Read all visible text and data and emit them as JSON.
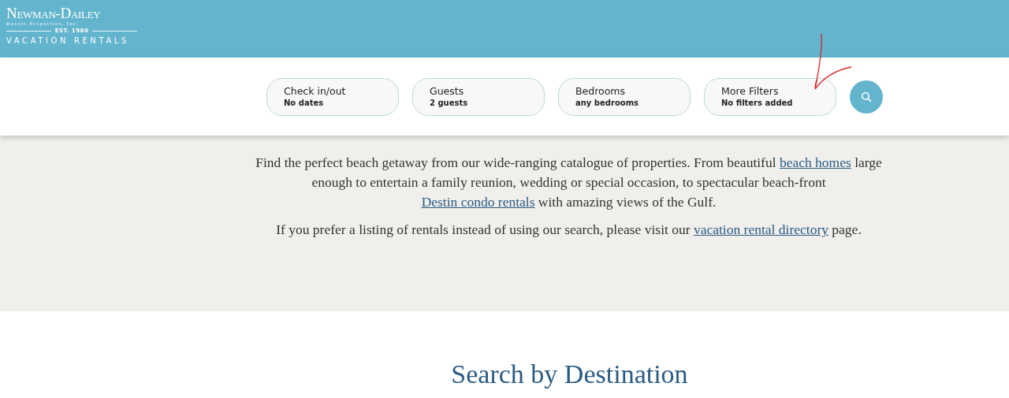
{
  "logo": {
    "name": "Newman-Dailey",
    "tagline": "Resort Properties, Inc.",
    "established": "EST. 1980",
    "subtitle": "VACATION RENTALS"
  },
  "search_bar": {
    "filters": [
      {
        "label": "Check in/out",
        "value": "No dates"
      },
      {
        "label": "Guests",
        "value": "2 guests"
      },
      {
        "label": "Bedrooms",
        "value": "any bedrooms"
      },
      {
        "label": "More Filters",
        "value": "No filters added"
      }
    ]
  },
  "intro": {
    "paragraphs": [
      [
        {
          "kind": "text",
          "text": "Find the perfect beach getaway from our wide-ranging catalogue of properties. From beautiful "
        },
        {
          "kind": "link",
          "text": "beach homes"
        },
        {
          "kind": "text",
          "text": " large enough to entertain a family reunion, wedding or special occasion, to spectacular beach-front "
        },
        {
          "kind": "link",
          "text": "Destin condo rentals"
        },
        {
          "kind": "text",
          "text": " with amazing views of the Gulf."
        }
      ],
      [
        {
          "kind": "text",
          "text": "If you prefer a listing of rentals instead of using our search, please visit our "
        },
        {
          "kind": "link",
          "text": "vacation rental directory"
        },
        {
          "kind": "text",
          "text": " page."
        }
      ]
    ]
  },
  "destinations": {
    "heading": "Search by Destination"
  }
}
